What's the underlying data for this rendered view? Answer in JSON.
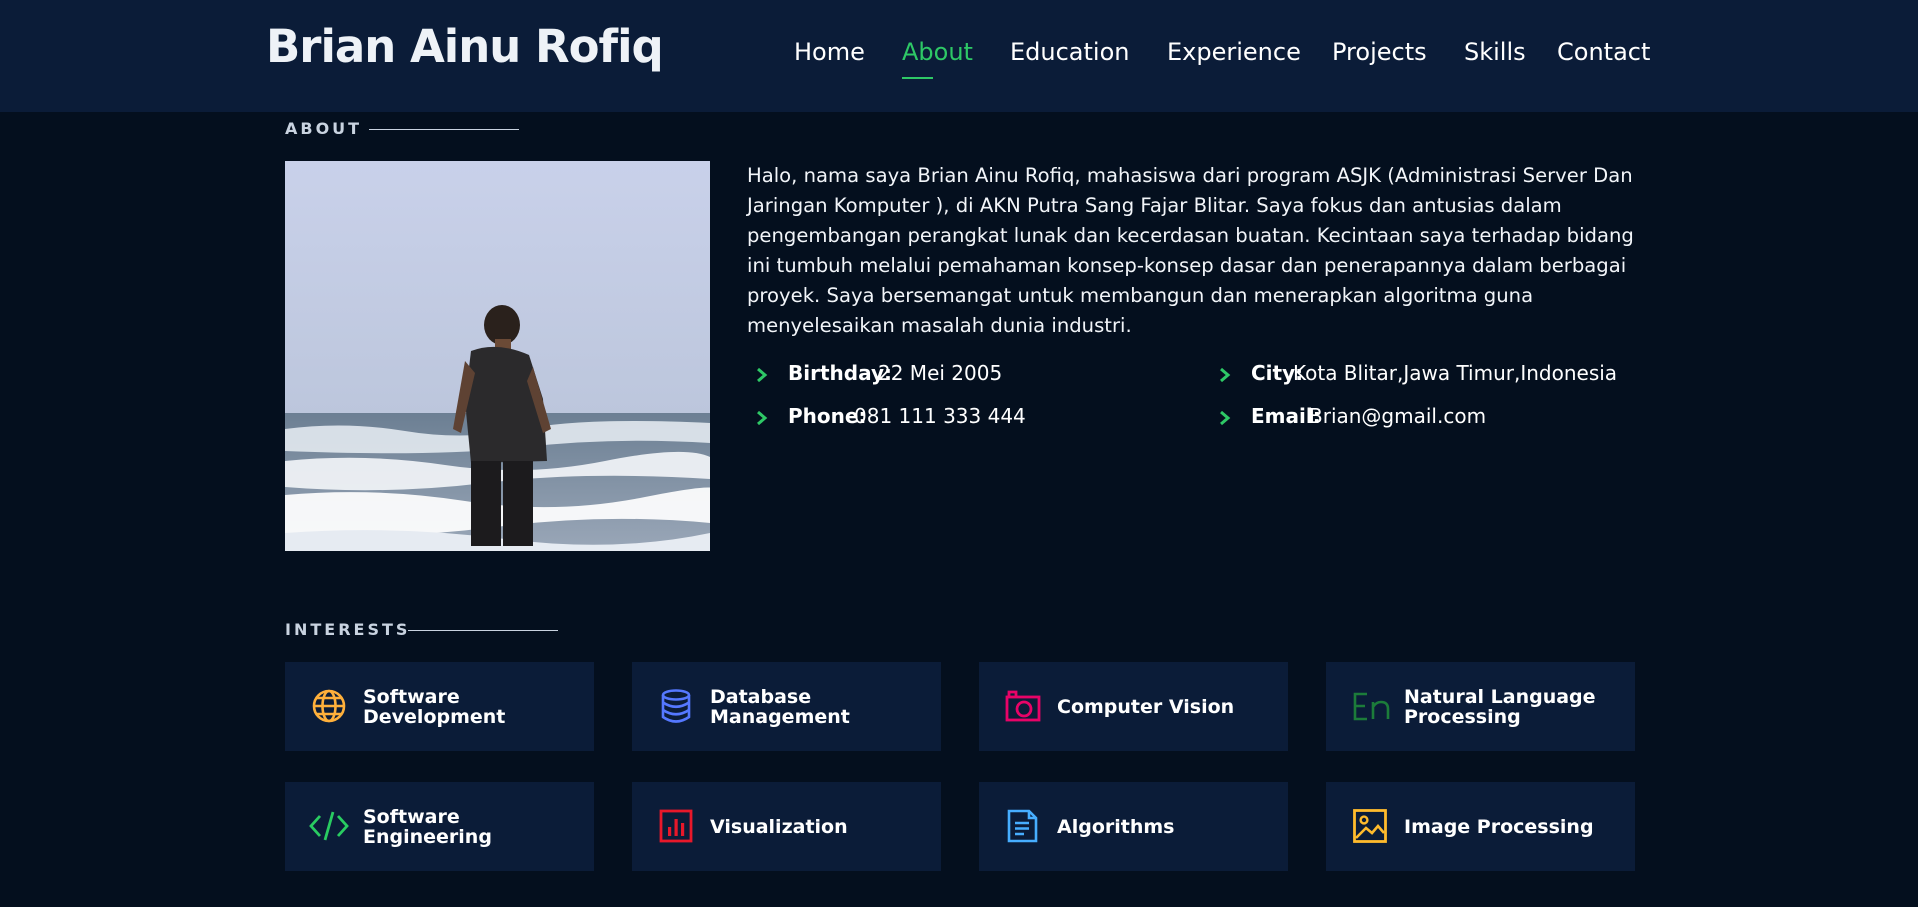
{
  "brand": "Brian Ainu Rofiq",
  "nav": [
    {
      "label": "Home"
    },
    {
      "label": "About"
    },
    {
      "label": "Education"
    },
    {
      "label": "Experience"
    },
    {
      "label": "Projects"
    },
    {
      "label": "Skills"
    },
    {
      "label": "Contact"
    }
  ],
  "active_nav": "About",
  "accent_color": "#2ec866",
  "about": {
    "section_title": "ABOUT",
    "text": "Halo, nama saya Brian Ainu Rofiq, mahasiswa dari program ASJK (Administrasi Server Dan Jaringan Komputer ), di AKN Putra Sang Fajar Blitar. Saya fokus dan antusias dalam pengembangan perangkat lunak dan kecerdasan buatan. Kecintaan saya terhadap bidang ini tumbuh melalui pemahaman konsep-konsep dasar dan penerapannya dalam berbagai proyek. Saya bersemangat untuk membangun dan menerapkan algoritma guna menyelesaikan masalah dunia industri.",
    "details": [
      {
        "label": "Birthday:",
        "value": "22 Mei 2005"
      },
      {
        "label": "City:",
        "value": "Kota Blitar,Jawa Timur,Indonesia"
      },
      {
        "label": "Phone:",
        "value": "081 111 333 444"
      },
      {
        "label": "Email:",
        "value": "Brian@gmail.com"
      }
    ]
  },
  "interests": {
    "section_title": "INTERESTS",
    "items": [
      {
        "label": "Software Development",
        "icon": "globe-icon",
        "color": "#ffb03b"
      },
      {
        "label": "Database Management",
        "icon": "database-icon",
        "color": "#5578ff"
      },
      {
        "label": "Computer Vision",
        "icon": "camera-icon",
        "color": "#e80368"
      },
      {
        "label": "Natural Language Processing",
        "icon": "language-en-icon",
        "color": "#1c7c3a"
      },
      {
        "label": "Software Engineering",
        "icon": "code-icon",
        "color": "#29cc61"
      },
      {
        "label": "Visualization",
        "icon": "bar-chart-icon",
        "color": "#e8182a"
      },
      {
        "label": "Algorithms",
        "icon": "document-icon",
        "color": "#47aeff"
      },
      {
        "label": "Image Processing",
        "icon": "image-icon",
        "color": "#ffbb2c"
      }
    ]
  }
}
